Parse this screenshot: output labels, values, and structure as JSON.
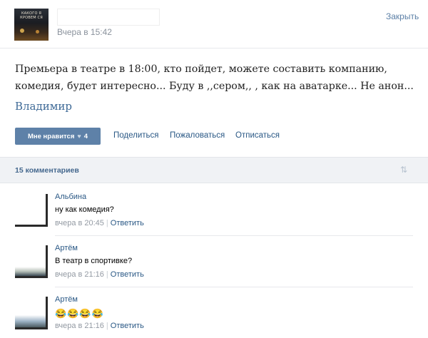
{
  "header": {
    "avatar_caption": "КАКОГО Я КРОВЕМ СЯ",
    "time": "Вчера в 15:42",
    "close_label": "Закрыть"
  },
  "post": {
    "text": "Премьера в театре в 18:00, кто пойдет, можете составить компанию, комедия, будет интересно... Буду в ,,сером,, , как на аватарке... Не анон...",
    "signature": "Владимир"
  },
  "actions": {
    "like_label": "Мне нравится",
    "like_icon": "heart-icon",
    "like_count": "4",
    "share_label": "Поделиться",
    "report_label": "Пожаловаться",
    "unsubscribe_label": "Отписаться"
  },
  "comments_bar": {
    "count_label": "15 комментариев",
    "sort_icon": "sort-arrows-icon"
  },
  "comments": [
    {
      "author": "Альбина",
      "text": "ну как комедия?",
      "time": "вчера в 20:45",
      "reply_label": "Ответить"
    },
    {
      "author": "Артём",
      "text": "В театр в спортивке?",
      "time": "вчера в 21:16",
      "reply_label": "Ответить"
    },
    {
      "author": "Артём",
      "text": "😂😂😂😂",
      "time": "вчера в 21:16",
      "reply_label": "Ответить"
    }
  ]
}
